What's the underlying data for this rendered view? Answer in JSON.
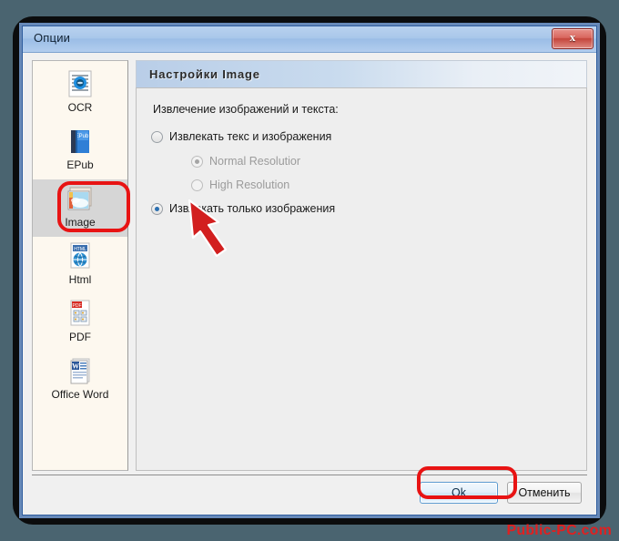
{
  "window": {
    "title": "Опции",
    "close_label": "x"
  },
  "sidebar": {
    "items": [
      {
        "label": "OCR",
        "icon": "ocr-icon",
        "selected": false
      },
      {
        "label": "EPub",
        "icon": "epub-book-icon",
        "selected": false
      },
      {
        "label": "Image",
        "icon": "image-photo-icon",
        "selected": true
      },
      {
        "label": "Html",
        "icon": "html-globe-icon",
        "selected": false
      },
      {
        "label": "PDF",
        "icon": "pdf-file-icon",
        "selected": false
      },
      {
        "label": "Office Word",
        "icon": "word-doc-icon",
        "selected": false
      }
    ]
  },
  "pane": {
    "header": "Настройки Image",
    "group_label": "Извлечение изображений и текста:",
    "options": [
      {
        "label": "Извлекать текс и изображения",
        "checked": false,
        "disabled": false,
        "indent": false
      },
      {
        "label": "Normal Resolutior",
        "checked": true,
        "disabled": true,
        "indent": true
      },
      {
        "label": "High Resolution",
        "checked": false,
        "disabled": true,
        "indent": true
      },
      {
        "label": "Извлекать только изображения",
        "checked": true,
        "disabled": false,
        "indent": false
      }
    ]
  },
  "footer": {
    "ok_label": "Ok",
    "cancel_label": "Отменить"
  },
  "annotations": {
    "highlight_color": "#e81313",
    "arrow_color": "#d21f1f",
    "watermark": "Public-PC.com"
  }
}
